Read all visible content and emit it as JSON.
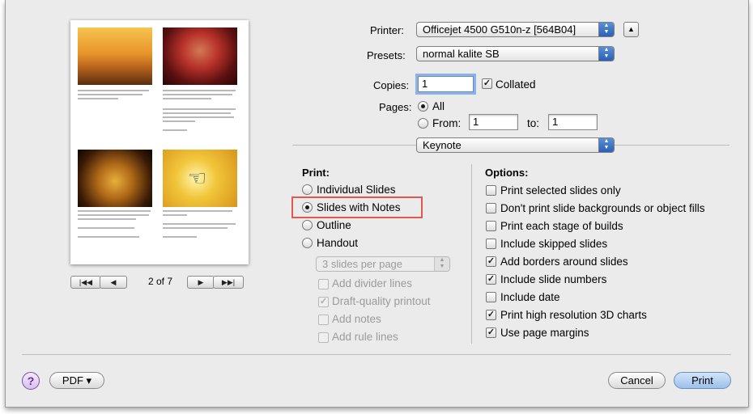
{
  "preview": {
    "page_counter": "2 of 7",
    "nav": {
      "first": "|◀◀",
      "prev": "◀",
      "next": "▶",
      "last": "▶▶|"
    }
  },
  "printer": {
    "label": "Printer:",
    "value": "Officejet 4500 G510n-z [564B04]"
  },
  "presets": {
    "label": "Presets:",
    "value": "normal kalite SB"
  },
  "copies": {
    "label": "Copies:",
    "value": "1",
    "collated_label": "Collated"
  },
  "pages": {
    "label": "Pages:",
    "all_label": "All",
    "from_label": "From:",
    "from_value": "1",
    "to_label": "to:",
    "to_value": "1"
  },
  "section_popup": {
    "value": "Keynote"
  },
  "print_group": {
    "heading": "Print:",
    "options": [
      "Individual Slides",
      "Slides with Notes",
      "Outline",
      "Handout"
    ],
    "selected_index": 1,
    "handout_popup": "3 slides per page",
    "sub_options": [
      "Add divider lines",
      "Draft-quality printout",
      "Add notes",
      "Add rule lines"
    ],
    "sub_checked": [
      false,
      true,
      false,
      false
    ]
  },
  "options_group": {
    "heading": "Options:",
    "items": [
      "Print selected slides only",
      "Don't print slide backgrounds or object fills",
      "Print each stage of builds",
      "Include skipped slides",
      "Add borders around slides",
      "Include slide numbers",
      "Include date",
      "Print high resolution 3D charts",
      "Use page margins"
    ],
    "checked": [
      false,
      false,
      false,
      false,
      true,
      true,
      false,
      true,
      true
    ]
  },
  "footer": {
    "help": "?",
    "pdf": "PDF ▾",
    "cancel": "Cancel",
    "print": "Print"
  },
  "colors": {
    "highlight": "#e2584f",
    "accent": "#2a5fb8"
  }
}
